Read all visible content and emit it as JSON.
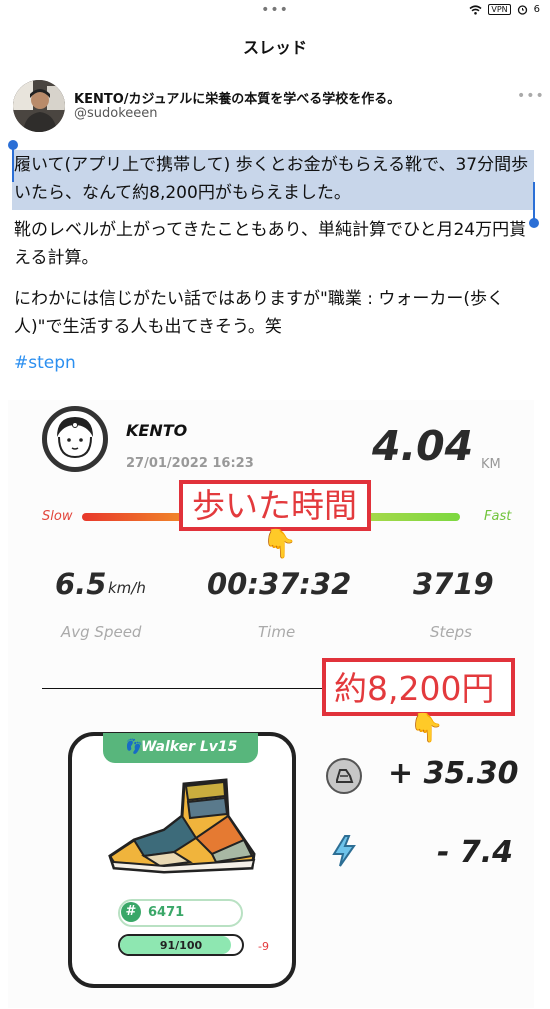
{
  "status_bar": {
    "vpn": "VPN",
    "battery": "6"
  },
  "nav": {
    "title": "スレッド"
  },
  "author": {
    "name": "KENTO/カジュアルに栄養の本質を学べる学校を作る。",
    "handle": "@sudokeeen"
  },
  "post": {
    "paragraph1": "履いて(アプリ上で携帯して) 歩くとお金がもらえる靴で、37分間歩いたら、なんて約8,200円がもらえました。",
    "paragraph2": "靴のレベルが上がってきたこともあり、単純計算でひと月24万円貰える計算。",
    "paragraph3": "にわかには信じがたい話ではありますが\"職業 : ウォーカー(歩く人)\"で生活する人も出てきそう。笑",
    "hashtag": "#stepn"
  },
  "stepn": {
    "user_name": "KENTO",
    "date": "27/01/2022 16:23",
    "distance": "4.04",
    "distance_unit": "KM",
    "slow_label": "Slow",
    "fast_label": "Fast",
    "annotation_time": "歩いた時間",
    "annotation_yen": "約8,200円",
    "avg_speed": "6.5",
    "avg_speed_unit": "km/h",
    "avg_speed_label": "Avg Speed",
    "time": "00:37:32",
    "time_label": "Time",
    "steps": "3719",
    "steps_label": "Steps",
    "shoe_level": "Walker Lv15",
    "shoe_id": "6471",
    "durability_text": "91/100",
    "durability_fraction": 0.91,
    "durability_change": "-9",
    "gst_earned": "+ 35.30",
    "energy_used": "- 7.4"
  },
  "colors": {
    "selection": "#c8d6ea",
    "link": "#2b8ff0",
    "annotation_red": "#e1323b",
    "shoe_green": "#58b67c"
  },
  "icons": [
    "wifi-icon",
    "alarm-icon",
    "more-options-icon",
    "pointing-hand-icon",
    "footprint-icon",
    "gst-coin-icon",
    "energy-bolt-icon"
  ]
}
